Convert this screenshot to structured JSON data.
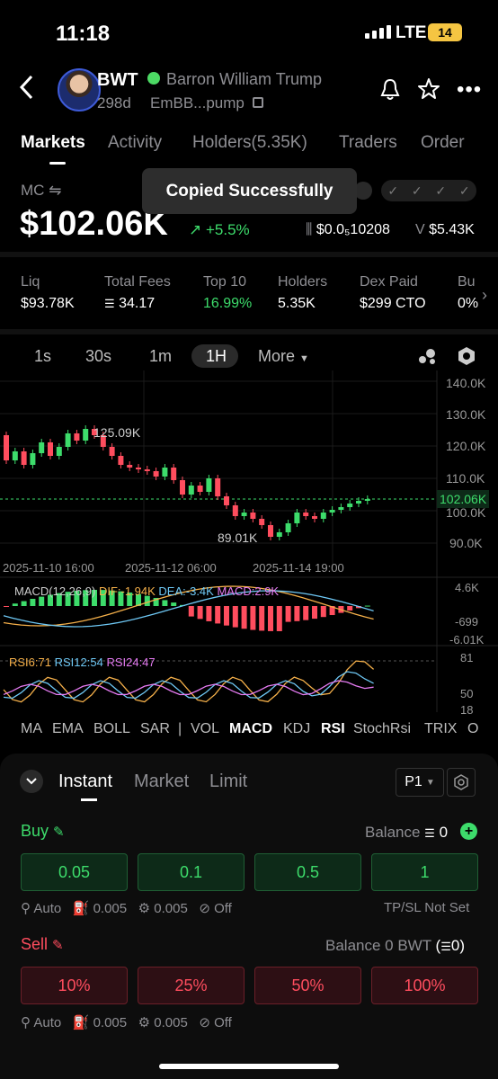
{
  "status": {
    "time": "11:18",
    "network": "LTE",
    "battery": "14"
  },
  "token": {
    "symbol": "BWT",
    "name": "Barron William Trump",
    "age": "298d",
    "address": "EmBB...pump"
  },
  "tabs": [
    "Markets",
    "Activity",
    "Holders(5.35K)",
    "Traders",
    "Order"
  ],
  "mc": {
    "label": "MC",
    "value": "$102.06K",
    "change": "+5.5%",
    "price": "$0.0₅10208",
    "volume_prefix": "V",
    "volume": "$5.43K"
  },
  "toast": "Copied Successfully",
  "stats": [
    {
      "label": "Liq",
      "value": "$93.78K"
    },
    {
      "label": "Total Fees",
      "value": "34.17"
    },
    {
      "label": "Top 10",
      "value": "16.99%"
    },
    {
      "label": "Holders",
      "value": "5.35K"
    },
    {
      "label": "Dex Paid",
      "value": "$299 CTO"
    },
    {
      "label": "Bu",
      "value": "0%"
    }
  ],
  "intervals": [
    "1s",
    "30s",
    "1m",
    "1H",
    "More"
  ],
  "chart": {
    "price_axis": [
      "140.0K",
      "130.0K",
      "120.0K",
      "110.0K",
      "102.06K",
      "100.0K",
      "90.0K"
    ],
    "high_label": "125.09K",
    "low_label": "89.01K",
    "dates": [
      "2025-11-10 16:00",
      "2025-11-12 06:00",
      "2025-11-14 19:00"
    ],
    "macd_legend": {
      "title": "MACD(12,26,9)",
      "dif": "DIF:-1.94K",
      "dea": "DEA:-3.4K",
      "macd": "MACD:2.9K"
    },
    "macd_axis": [
      "4.6K",
      "-699",
      "-6.01K"
    ],
    "rsi_legend": {
      "rsi6": "RSI6:71",
      "rsi12": "RSI12:54",
      "rsi24": "RSI24:47"
    },
    "rsi_axis": [
      "81",
      "50",
      "18"
    ]
  },
  "indicators": [
    "MA",
    "EMA",
    "BOLL",
    "SAR",
    "|",
    "VOL",
    "MACD",
    "KDJ",
    "RSI",
    "StochRsi",
    "TRIX",
    "O"
  ],
  "trade": {
    "order_tabs": [
      "Instant",
      "Market",
      "Limit"
    ],
    "preset": "P1",
    "buy_label": "Buy",
    "balance_label": "Balance",
    "balance_value": "0",
    "buy_amounts": [
      "0.05",
      "0.1",
      "0.5",
      "1"
    ],
    "settings": [
      "Auto",
      "0.005",
      "0.005",
      "Off"
    ],
    "tpsl": "TP/SL Not Set",
    "sell_label": "Sell",
    "sell_balance": "Balance 0 BWT",
    "sell_balance_alt": "0",
    "sell_amounts": [
      "10%",
      "25%",
      "50%",
      "100%"
    ]
  }
}
